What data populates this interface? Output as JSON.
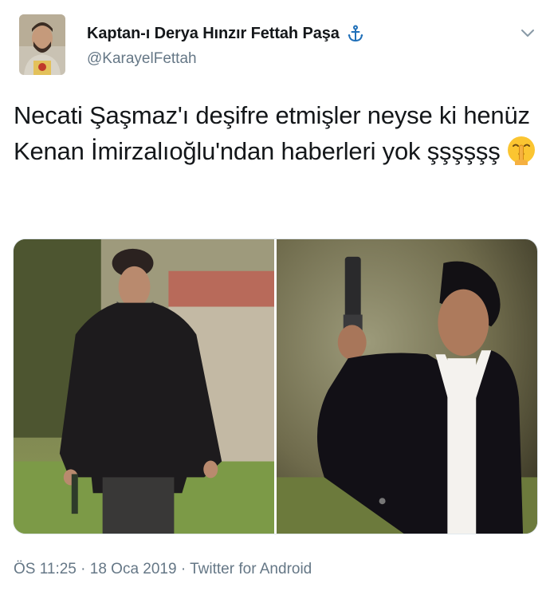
{
  "author": {
    "display_name": "Kaptan-ı Derya Hınzır Fettah Paşa",
    "handle": "@KarayelFettah",
    "avatar_icon": "profile-photo",
    "badge_icon": "anchor-icon"
  },
  "tweet": {
    "text": "Necati Şaşmaz'ı deşifre etmişler neyse ki henüz Kenan İmirzalıoğlu'ndan haberleri yok şşşşşş",
    "emoji_icon": "shushing-face-icon"
  },
  "media": {
    "count": 2,
    "photos": [
      "left-photo",
      "right-photo"
    ]
  },
  "meta": {
    "time": "ÖS 11:25",
    "separator": " · ",
    "date": "18 Oca 2019",
    "source": "Twitter for Android"
  },
  "colors": {
    "text_primary": "#14171a",
    "text_secondary": "#657786",
    "accent": "#1da1f2"
  }
}
